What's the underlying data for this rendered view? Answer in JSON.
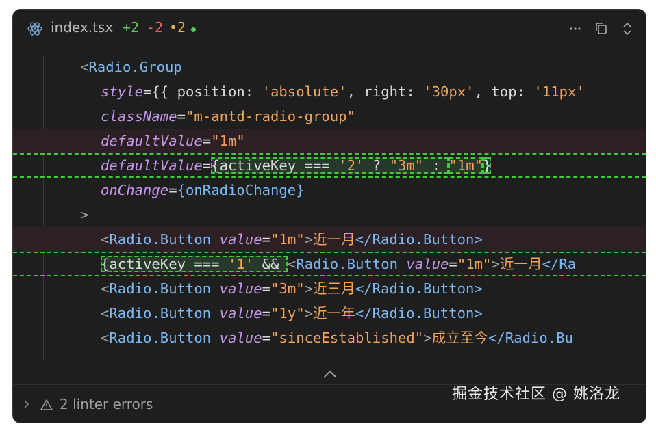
{
  "header": {
    "file_name": "index.tsx",
    "added": "+2",
    "removed": "-2",
    "modified": "•2",
    "more_icon": "ellipsis-icon",
    "copy_icon": "copy-icon",
    "expand_icon": "chevron-updown-icon"
  },
  "colors": {
    "added": "#5fc65f",
    "removed": "#e0635f",
    "modified": "#e3b341",
    "diff_outline": "#43c938"
  },
  "code": {
    "l1": {
      "lt": "<",
      "tag": "Radio.Group"
    },
    "l2": {
      "attr": "style",
      "pre": "={{ position: ",
      "s1": "'absolute'",
      "mid1": ", right: ",
      "s2": "'30px'",
      "mid2": ", top: ",
      "s3": "'11px'"
    },
    "l3": {
      "attr": "className",
      "eq": "=",
      "val": "\"m-antd-radio-group\""
    },
    "l4": {
      "attr": "defaultValue",
      "eq": "=",
      "val": "\"1m\""
    },
    "l5": {
      "attr": "defaultValue",
      "eq": "=",
      "open": "{activeKey === ",
      "k": "'2'",
      "q": " ? ",
      "v1": "\"3m\"",
      "colon": " : ",
      "v2": "\"1m\"",
      "close": "}"
    },
    "l6": {
      "attr": "onChange",
      "eq": "=",
      "val": "{onRadioChange}"
    },
    "l7": {
      "gt": ">"
    },
    "l8": {
      "lt": "<",
      "tag": "Radio.Button",
      "attr": "value",
      "eq": "=",
      "val": "\"1m\"",
      "gt": ">",
      "text": "近一月",
      "close": "</Radio.Button>"
    },
    "l9": {
      "open": "{activeKey === ",
      "k": "'1'",
      "amp": " && ",
      "lt": "<",
      "tag": "Radio.Button",
      "attr": "value",
      "eq": "=",
      "val": "\"1m\"",
      "gt": ">",
      "text": "近一月",
      "close": "</Ra"
    },
    "l10": {
      "lt": "<",
      "tag": "Radio.Button",
      "attr": "value",
      "eq": "=",
      "val": "\"3m\"",
      "gt": ">",
      "text": "近三月",
      "close": "</Radio.Button>"
    },
    "l11": {
      "lt": "<",
      "tag": "Radio.Button",
      "attr": "value",
      "eq": "=",
      "val": "\"1y\"",
      "gt": ">",
      "text": "近一年",
      "close": "</Radio.Button>"
    },
    "l12": {
      "lt": "<",
      "tag": "Radio.Button",
      "attr": "value",
      "eq": "=",
      "val": "\"sinceEstablished\"",
      "gt": ">",
      "text": "成立至今",
      "close": "</Radio.Bu"
    }
  },
  "footer": {
    "linter_label": "2 linter errors",
    "expand_icon": "chevron-right-icon",
    "warning_icon": "warning-icon"
  },
  "watermark": "掘金技术社区 @ 姚洛龙"
}
